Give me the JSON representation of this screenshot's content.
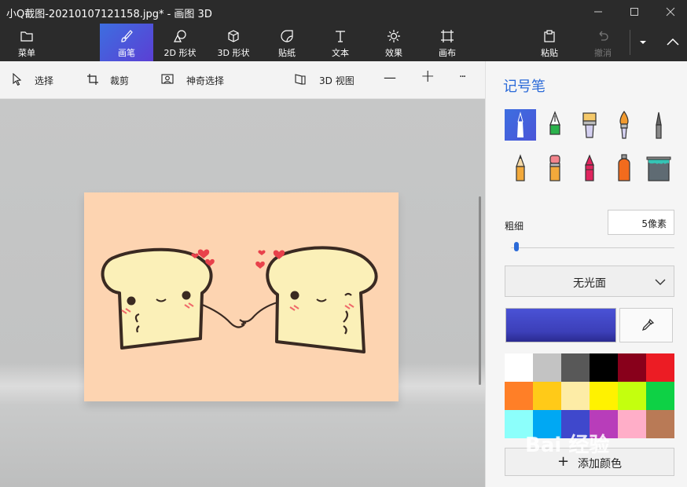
{
  "window": {
    "title": "小Q截图-20210107121158.jpg* - 画图 3D"
  },
  "ribbon": {
    "tabs": [
      {
        "label": "菜单",
        "icon": "folder-icon"
      },
      {
        "label": "画笔",
        "icon": "brush-icon"
      },
      {
        "label": "2D 形状",
        "icon": "shapes-2d-icon"
      },
      {
        "label": "3D 形状",
        "icon": "cube-icon"
      },
      {
        "label": "贴纸",
        "icon": "sticker-icon"
      },
      {
        "label": "文本",
        "icon": "text-icon"
      },
      {
        "label": "效果",
        "icon": "effects-icon"
      },
      {
        "label": "画布",
        "icon": "canvas-icon"
      }
    ],
    "paste_label": "粘贴",
    "undo_label": "撤消",
    "active_color": "#3d6ee0"
  },
  "toolbar": {
    "select_label": "选择",
    "crop_label": "裁剪",
    "magic_select_label": "神奇选择",
    "view3d_label": "3D 视图",
    "zoom_out_symbol": "—",
    "zoom_in_symbol": "+",
    "more_symbol": "···"
  },
  "panel": {
    "title": "记号笔",
    "brushes": [
      "marker-icon",
      "calligraphy-pen-icon",
      "oil-brush-icon",
      "watercolor-icon",
      "pixel-pen-icon",
      "pencil-icon",
      "eraser-icon",
      "crayon-icon",
      "spray-can-icon",
      "fill-bucket-icon"
    ],
    "selected_brush": 0,
    "size_label": "粗细",
    "size_value": "5像素",
    "size_level": 0.02,
    "finish_value": "无光面",
    "current_color": "#4a52d6",
    "palette": [
      "#ffffff",
      "#c3c3c3",
      "#585858",
      "#000000",
      "#88001b",
      "#ec1c24",
      "#ff7f27",
      "#ffca18",
      "#fdeca6",
      "#fff200",
      "#c4ff0e",
      "#0ed145",
      "#8cfffb",
      "#00a8f3",
      "#3f48cc",
      "#b83dba",
      "#ffaec8",
      "#b97a56"
    ],
    "add_color_label": "添加颜色"
  },
  "watermark": "Bai  经验"
}
